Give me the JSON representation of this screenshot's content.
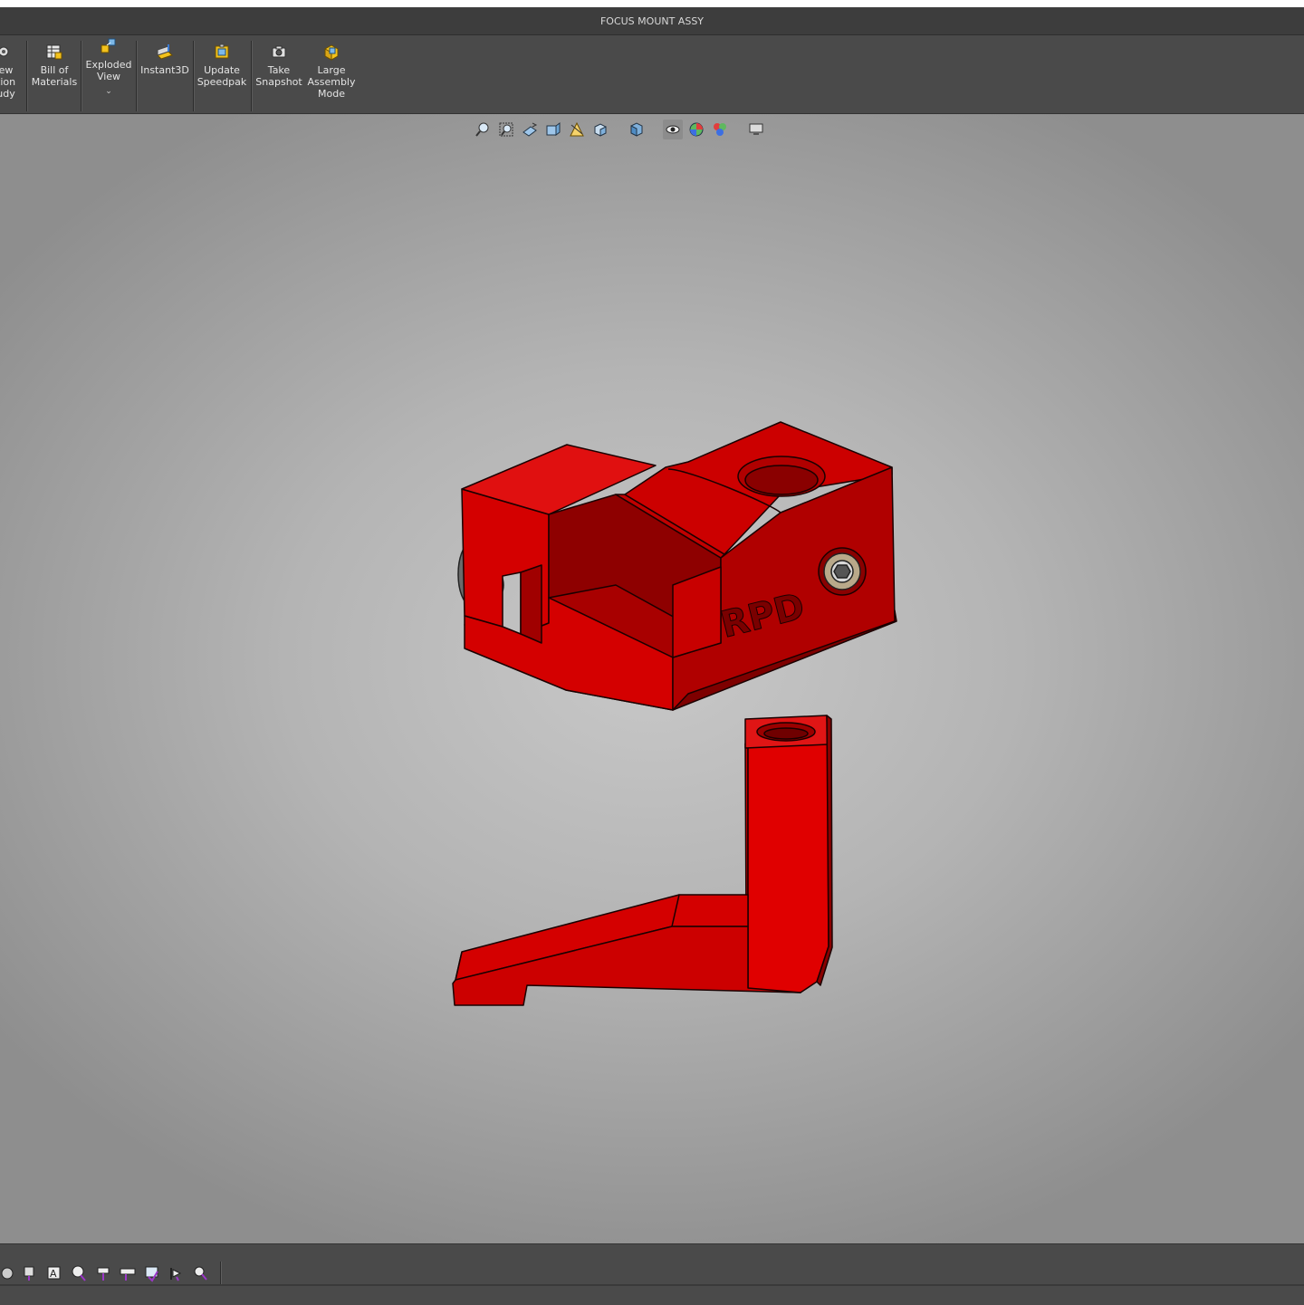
{
  "window": {
    "title": "FOCUS MOUNT ASSY"
  },
  "ribbon": {
    "buttons": [
      {
        "label": "ew\ntion\nudy",
        "icon": "motion-study-icon"
      },
      {
        "label": "Bill of\nMaterials",
        "icon": "bill-of-materials-icon"
      },
      {
        "label": "Exploded\nView",
        "icon": "exploded-view-icon",
        "dropdown": "⌄"
      },
      {
        "label": "Instant3D",
        "icon": "instant3d-icon"
      },
      {
        "label": "Update\nSpeedpak",
        "icon": "speedpak-icon"
      },
      {
        "label": "Take\nSnapshot",
        "icon": "camera-icon"
      },
      {
        "label": "Large\nAssembly\nMode",
        "icon": "large-assembly-icon"
      }
    ]
  },
  "heads_up_toolbar": {
    "icons": [
      "zoom-to-fit-icon",
      "zoom-to-area-icon",
      "previous-view-icon",
      "section-view-icon",
      "dynamic-annotation-icon",
      "view-orientation-icon",
      "display-style-icon",
      "hide-show-items-icon",
      "edit-appearance-icon",
      "apply-scene-icon",
      "view-settings-icon"
    ]
  },
  "model": {
    "label_on_part": "RPD",
    "colors": {
      "part": "#d40000",
      "part_dark": "#a80000",
      "part_darker": "#7e0000",
      "edge": "#1a0000"
    }
  },
  "status_bar": {
    "icons": [
      "smart-dimension-icon",
      "mate-icon",
      "note-icon",
      "balloon-icon",
      "datum-feature-icon",
      "geometric-tolerance-icon",
      "surface-finish-icon",
      "weld-symbol-icon",
      "hole-callout-icon"
    ]
  }
}
